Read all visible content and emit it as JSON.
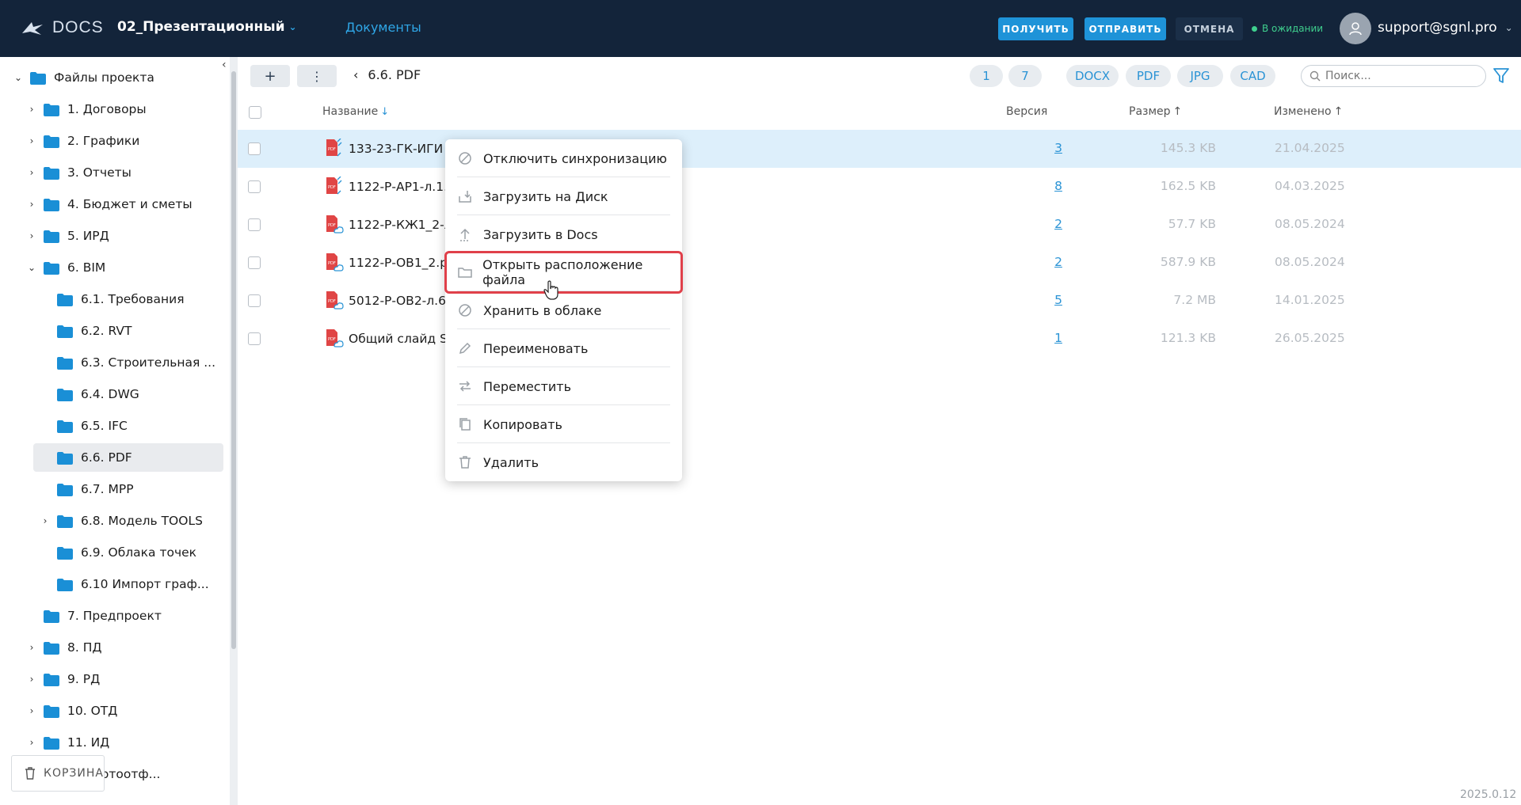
{
  "header": {
    "logo_text": "DOCS",
    "project": "02_Презентационный",
    "nav_docs": "Документы",
    "btn_get": "ПОЛУЧИТЬ",
    "btn_send": "ОТПРАВИТЬ",
    "btn_cancel": "ОТМЕНА",
    "status": "В ожидании",
    "user": "support@sgnl.pro"
  },
  "sidebar": {
    "root": "Файлы проекта",
    "items": [
      {
        "label": "1. Договоры",
        "arrow": "›"
      },
      {
        "label": "2. Графики",
        "arrow": "›"
      },
      {
        "label": "3. Отчеты",
        "arrow": "›"
      },
      {
        "label": "4. Бюджет и сметы",
        "arrow": "›"
      },
      {
        "label": "5. ИРД",
        "arrow": "›"
      },
      {
        "label": "6. BIM",
        "arrow": "⌄"
      },
      {
        "label": "6.1. Требования",
        "arrow": ""
      },
      {
        "label": "6.2. RVT",
        "arrow": ""
      },
      {
        "label": "6.3. Строительная ...",
        "arrow": ""
      },
      {
        "label": "6.4. DWG",
        "arrow": ""
      },
      {
        "label": "6.5. IFC",
        "arrow": ""
      },
      {
        "label": "6.6. PDF",
        "arrow": ""
      },
      {
        "label": "6.7. MPP",
        "arrow": ""
      },
      {
        "label": "6.8. Модель TOOLS",
        "arrow": "›"
      },
      {
        "label": "6.9. Облака точек",
        "arrow": ""
      },
      {
        "label": "6.10 Импорт граф...",
        "arrow": ""
      },
      {
        "label": "7. Предпроект",
        "arrow": ""
      },
      {
        "label": "8. ПД",
        "arrow": "›"
      },
      {
        "label": "9. РД",
        "arrow": "›"
      },
      {
        "label": "10. ОТД",
        "arrow": "›"
      },
      {
        "label": "11. ИД",
        "arrow": "›"
      },
      {
        "label": "12. Фотоотф...",
        "arrow": "›"
      }
    ],
    "trash": "КОРЗИНА"
  },
  "toolbar": {
    "breadcrumb": "6.6. PDF",
    "chips": [
      "1",
      "7",
      "DOCX",
      "PDF",
      "JPG",
      "CAD"
    ],
    "search_placeholder": "Поиск..."
  },
  "table": {
    "headers": {
      "name": "Название",
      "version": "Версия",
      "size": "Размер",
      "modified": "Изменено"
    },
    "rows": [
      {
        "name": "133-23-ГК-ИГИ Кн",
        "version": "3",
        "size": "145.3 KB",
        "date": "21.04.2025"
      },
      {
        "name": "1122-Р-АР1-л.1.pdf",
        "version": "8",
        "size": "162.5 KB",
        "date": "04.03.2025"
      },
      {
        "name": "1122-Р-КЖ1_2-л.1",
        "version": "2",
        "size": "57.7 KB",
        "date": "08.05.2024"
      },
      {
        "name": "1122-Р-ОВ1_2.pdf",
        "version": "2",
        "size": "587.9 KB",
        "date": "08.05.2024"
      },
      {
        "name": "5012-Р-ОВ2-л.6.pdf",
        "version": "5",
        "size": "7.2 MB",
        "date": "14.01.2025"
      },
      {
        "name": "Общий слайд SIGNAL",
        "version": "1",
        "size": "121.3 KB",
        "date": "26.05.2025"
      }
    ]
  },
  "menu": {
    "items": [
      "Отключить синхронизацию",
      "Загрузить на Диск",
      "Загрузить в Docs",
      "Открыть расположение файла",
      "Хранить в облаке",
      "Переименовать",
      "Переместить",
      "Копировать",
      "Удалить"
    ]
  },
  "footer": {
    "version": "2025.0.12"
  },
  "colors": {
    "header_bg": "#13243a",
    "accent": "#1e93d8",
    "link": "#2a93d5",
    "selected_row": "#ddeffb",
    "highlight": "#e0404a",
    "folder": "#1a8fd6"
  }
}
